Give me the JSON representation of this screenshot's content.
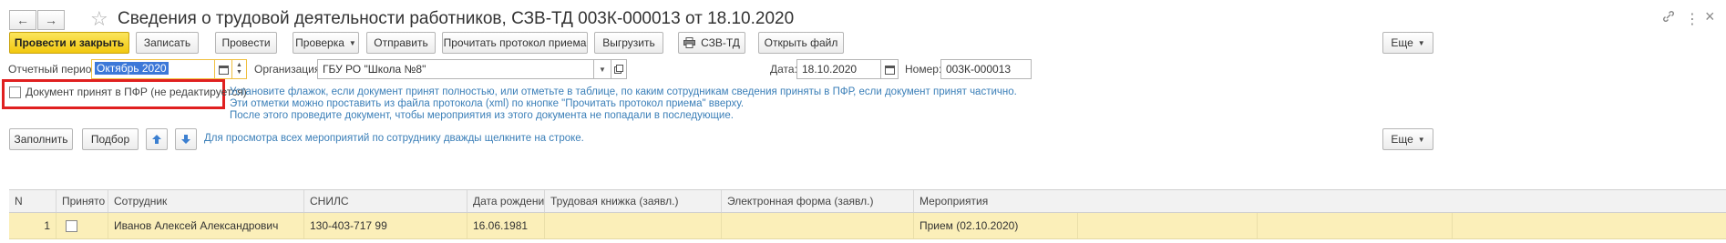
{
  "window": {
    "title": "Сведения о трудовой деятельности работников, СЗВ-ТД 003К-000013 от 18.10.2020",
    "back_icon": "←",
    "forward_icon": "→",
    "star_icon": "☆",
    "link_icon": "🔗",
    "more_icon": "⋮",
    "close_icon": "×"
  },
  "toolbar": {
    "post_and_close": "Провести и закрыть",
    "save": "Записать",
    "post": "Провести",
    "check": "Проверка",
    "send": "Отправить",
    "read_protocol": "Прочитать протокол приема",
    "upload": "Выгрузить",
    "szv_td": "СЗВ-ТД",
    "open_file": "Открыть файл",
    "more": "Еще"
  },
  "form": {
    "period_label": "Отчетный период:",
    "period_value": "Октябрь 2020",
    "org_label": "Организация:",
    "org_value": "ГБУ РО \"Школа №8\"",
    "date_label": "Дата:",
    "date_value": "18.10.2020",
    "number_label": "Номер:",
    "number_value": "003К-000013",
    "accepted_checkbox_label": "Документ принят в ПФР (не редактируется)",
    "accepted_checked": false,
    "hint_lines": [
      "Установите флажок, если документ принят полностью, или отметьте в таблице, по каким сотрудникам сведения приняты в ПФР, если документ принят частично.",
      "Эти отметки можно проставить из файла протокола (xml) по кнопке \"Прочитать протокол приема\" вверху.",
      "После этого проведите документ, чтобы мероприятия из этого документа не попадали в последующие."
    ]
  },
  "table_toolbar": {
    "fill": "Заполнить",
    "select": "Подбор",
    "hint": "Для просмотра всех мероприятий по сотруднику дважды щелкните на строке.",
    "more": "Еще"
  },
  "table": {
    "columns": [
      "N",
      "Принято",
      "Сотрудник",
      "СНИЛС",
      "Дата рождения",
      "Трудовая книжка (заявл.)",
      "Электронная форма (заявл.)",
      "Мероприятия"
    ],
    "rows": [
      {
        "n": "1",
        "accepted": false,
        "employee": "Иванов Алексей Александрович",
        "snils": "130-403-717 99",
        "birth_date": "16.06.1981",
        "paper_book": "",
        "electronic_form": "",
        "events": "Прием (02.10.2020)"
      }
    ]
  },
  "colors": {
    "primary_button": "#f2c80f",
    "hint_text": "#3b7fb8",
    "highlight_frame": "#e02020",
    "selected_row": "#fbefb9",
    "period_field_border": "#f0c040"
  }
}
